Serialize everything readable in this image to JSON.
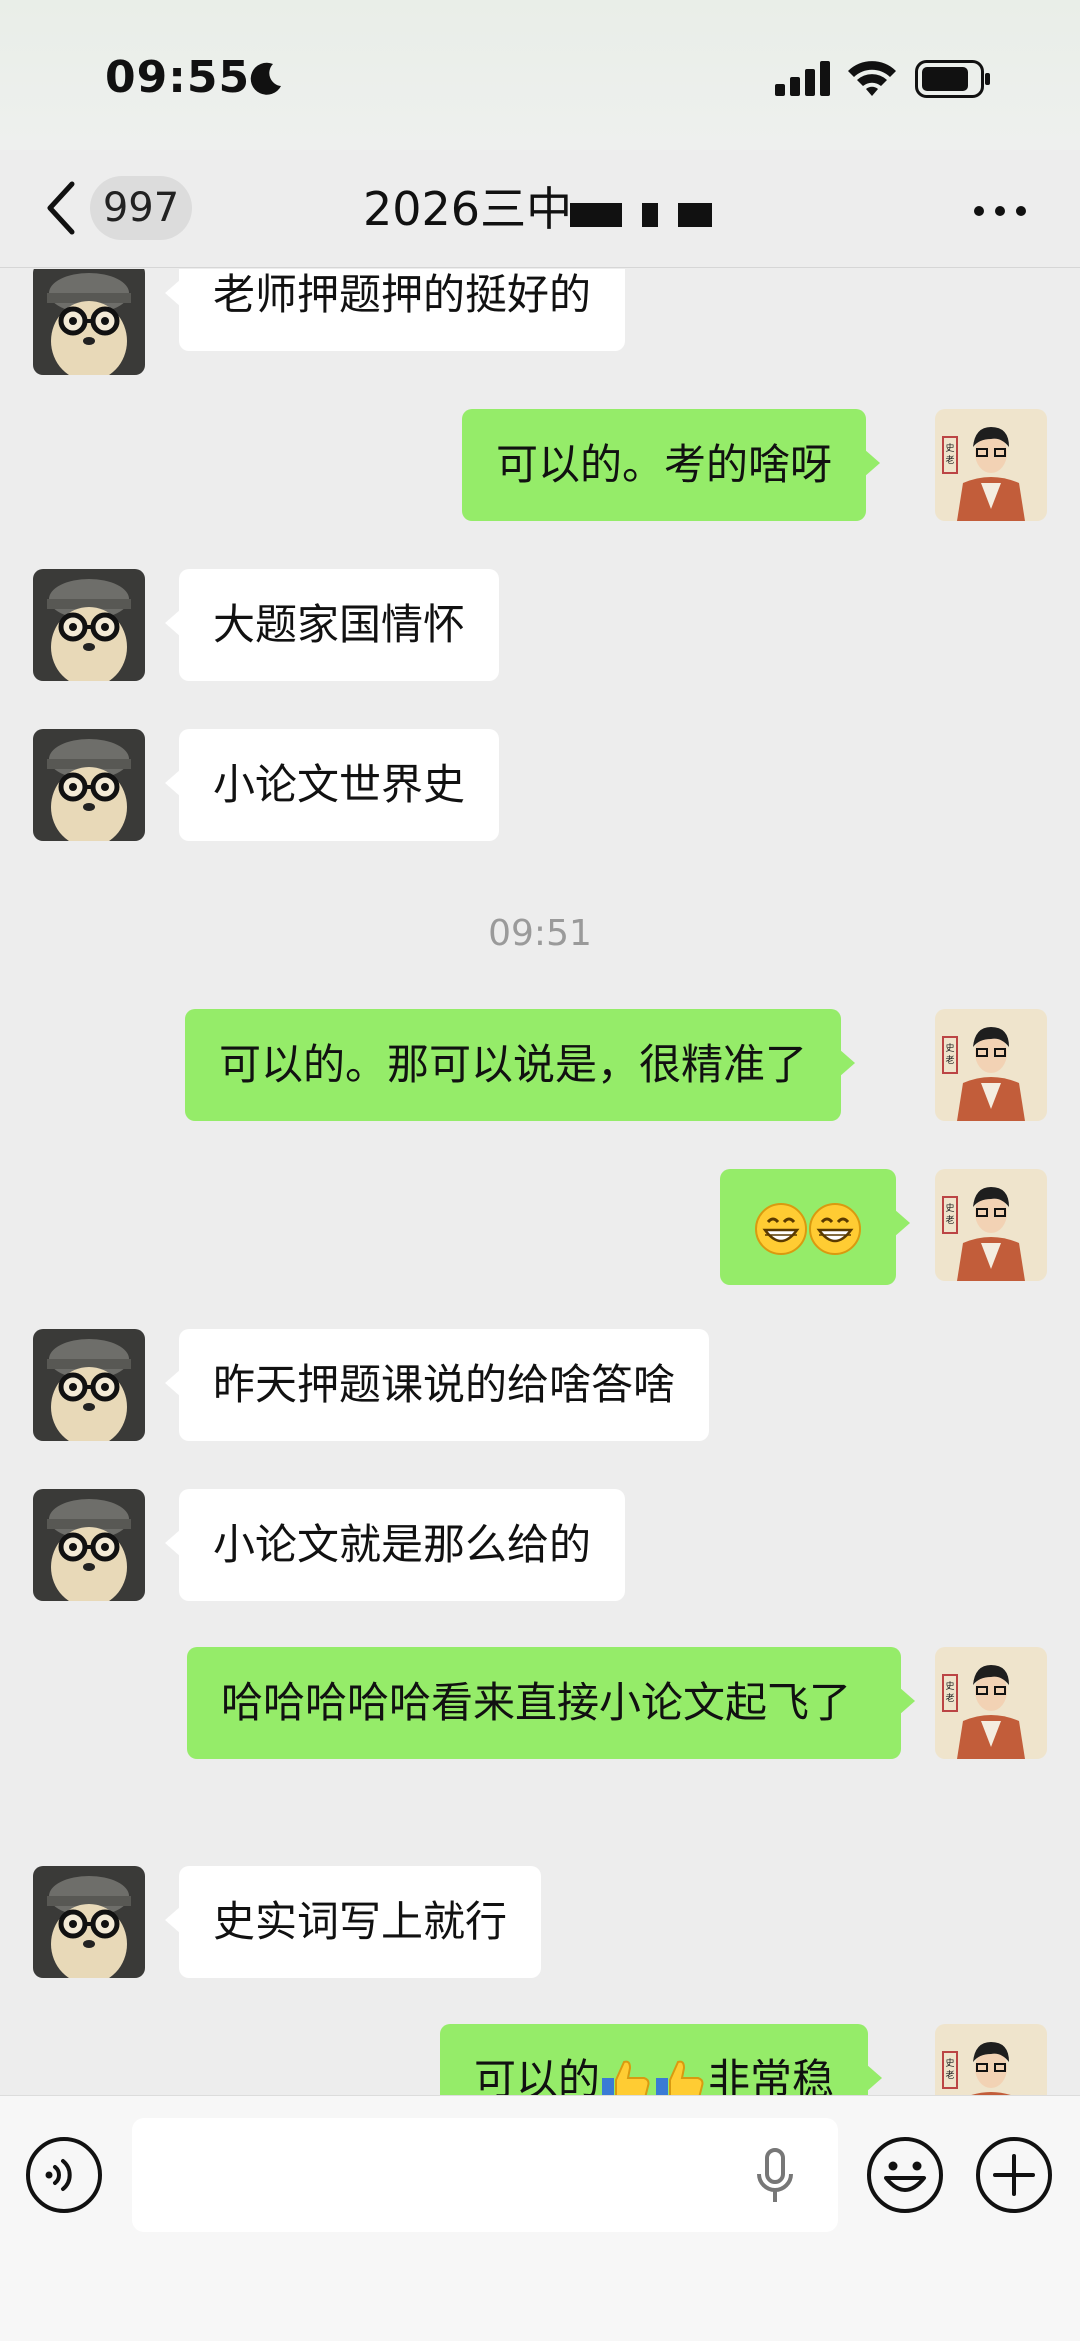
{
  "status_bar": {
    "time": "09:55"
  },
  "header": {
    "back_count": "997",
    "title": "2026三中"
  },
  "messages": [
    {
      "side": "in",
      "text": "老师押题押的挺好的"
    },
    {
      "side": "out",
      "text": "可以的。考的啥呀"
    },
    {
      "side": "in",
      "text": "大题家国情怀"
    },
    {
      "side": "in",
      "text": "小论文世界史"
    },
    {
      "type": "timestamp",
      "text": "09:51"
    },
    {
      "side": "out",
      "text": "可以的。那可以说是，很精准了"
    },
    {
      "side": "out",
      "text": "",
      "emoji": [
        "grinning-face",
        "grinning-face"
      ]
    },
    {
      "side": "in",
      "text": "昨天押题课说的给啥答啥"
    },
    {
      "side": "in",
      "text": "小论文就是那么给的"
    },
    {
      "side": "out",
      "text": "哈哈哈哈哈看来直接小论文起飞了"
    },
    {
      "side": "in",
      "text": "史实词写上就行"
    },
    {
      "side": "out",
      "text_before": "可以的",
      "text_after": "非常稳",
      "emoji": [
        "thumbs-up",
        "thumbs-up"
      ]
    }
  ],
  "colors": {
    "outgoing_bubble": "#95ec69",
    "incoming_bubble": "#ffffff",
    "background": "#ededed"
  }
}
